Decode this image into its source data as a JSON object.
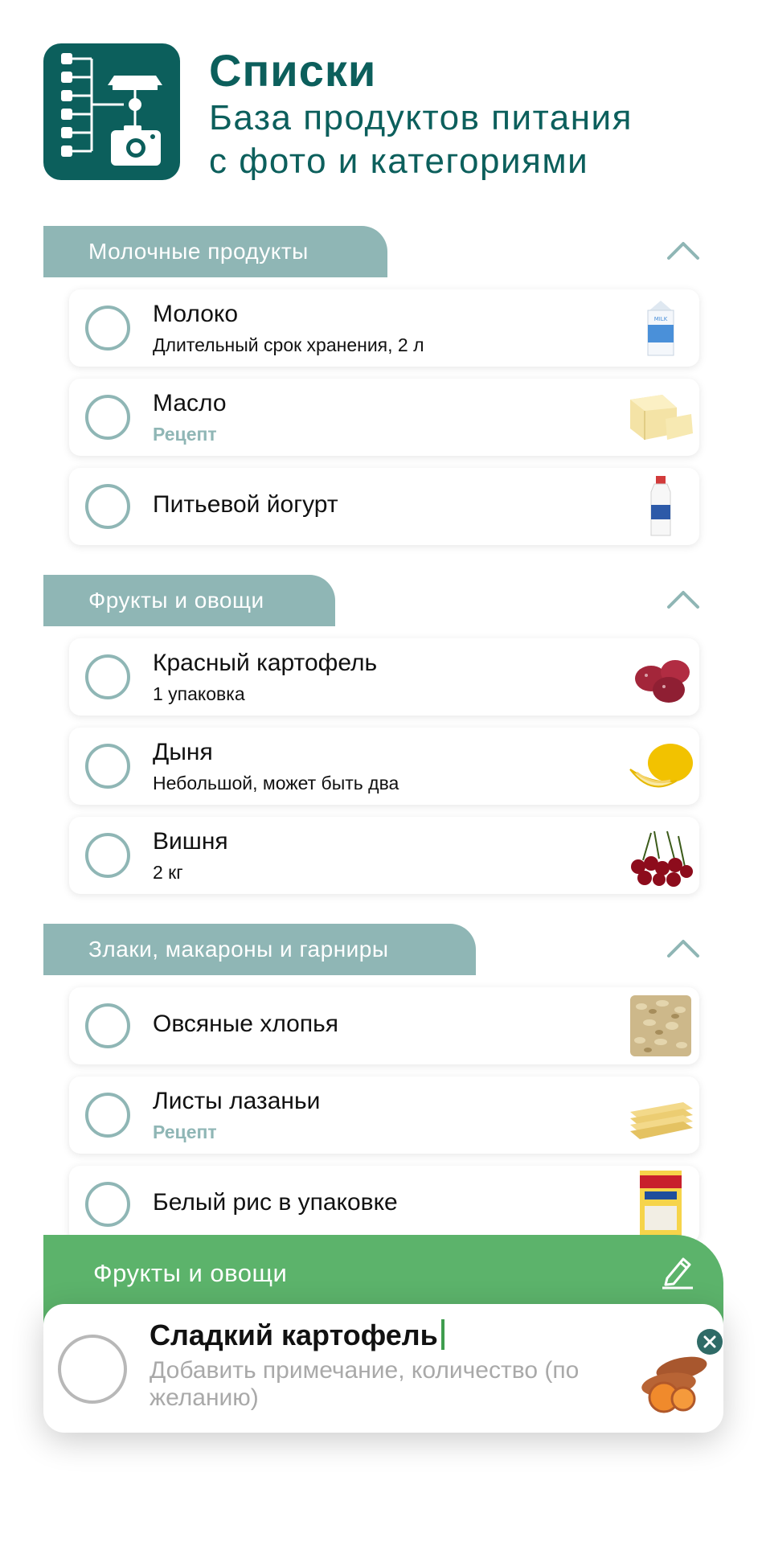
{
  "header": {
    "title": "Списки",
    "subtitle_line1": "База продуктов питания",
    "subtitle_line2": "с фото и категориями",
    "icon": "list-camera-icon",
    "brand_color": "#0c5f5c"
  },
  "colors": {
    "accent": "#8fb6b5",
    "editor_green": "#5cb36b",
    "caret": "#3f9d4e"
  },
  "sections": [
    {
      "title": "Молочные продукты",
      "items": [
        {
          "name": "Молоко",
          "note": "Длительный срок хранения, 2 л",
          "icon": "milk-carton-icon"
        },
        {
          "name": "Масло",
          "note": "Рецепт",
          "note_type": "recipe",
          "icon": "butter-icon"
        },
        {
          "name": "Питьевой йогурт",
          "note": "",
          "icon": "yogurt-bottle-icon"
        }
      ]
    },
    {
      "title": "Фрукты и овощи",
      "items": [
        {
          "name": "Красный картофель",
          "note": "1 упаковка",
          "icon": "red-potato-icon"
        },
        {
          "name": "Дыня",
          "note": "Небольшой, может быть два",
          "icon": "melon-icon"
        },
        {
          "name": "Вишня",
          "note": "2 кг",
          "icon": "cherries-icon"
        }
      ]
    },
    {
      "title": "Злаки, макароны и гарниры",
      "items": [
        {
          "name": "Овсяные хлопья",
          "note": "",
          "icon": "oats-icon"
        },
        {
          "name": "Листы лазаньи",
          "note": "Рецепт",
          "note_type": "recipe",
          "icon": "lasagna-sheets-icon"
        },
        {
          "name": "Белый рис в упаковке",
          "note": "",
          "icon": "rice-box-icon"
        }
      ]
    }
  ],
  "editor": {
    "category": "Фрукты и овощи",
    "item_name": "Сладкий картофель",
    "note_placeholder": "Добавить примечание, количество (по желанию)",
    "icon": "sweet-potato-icon"
  }
}
